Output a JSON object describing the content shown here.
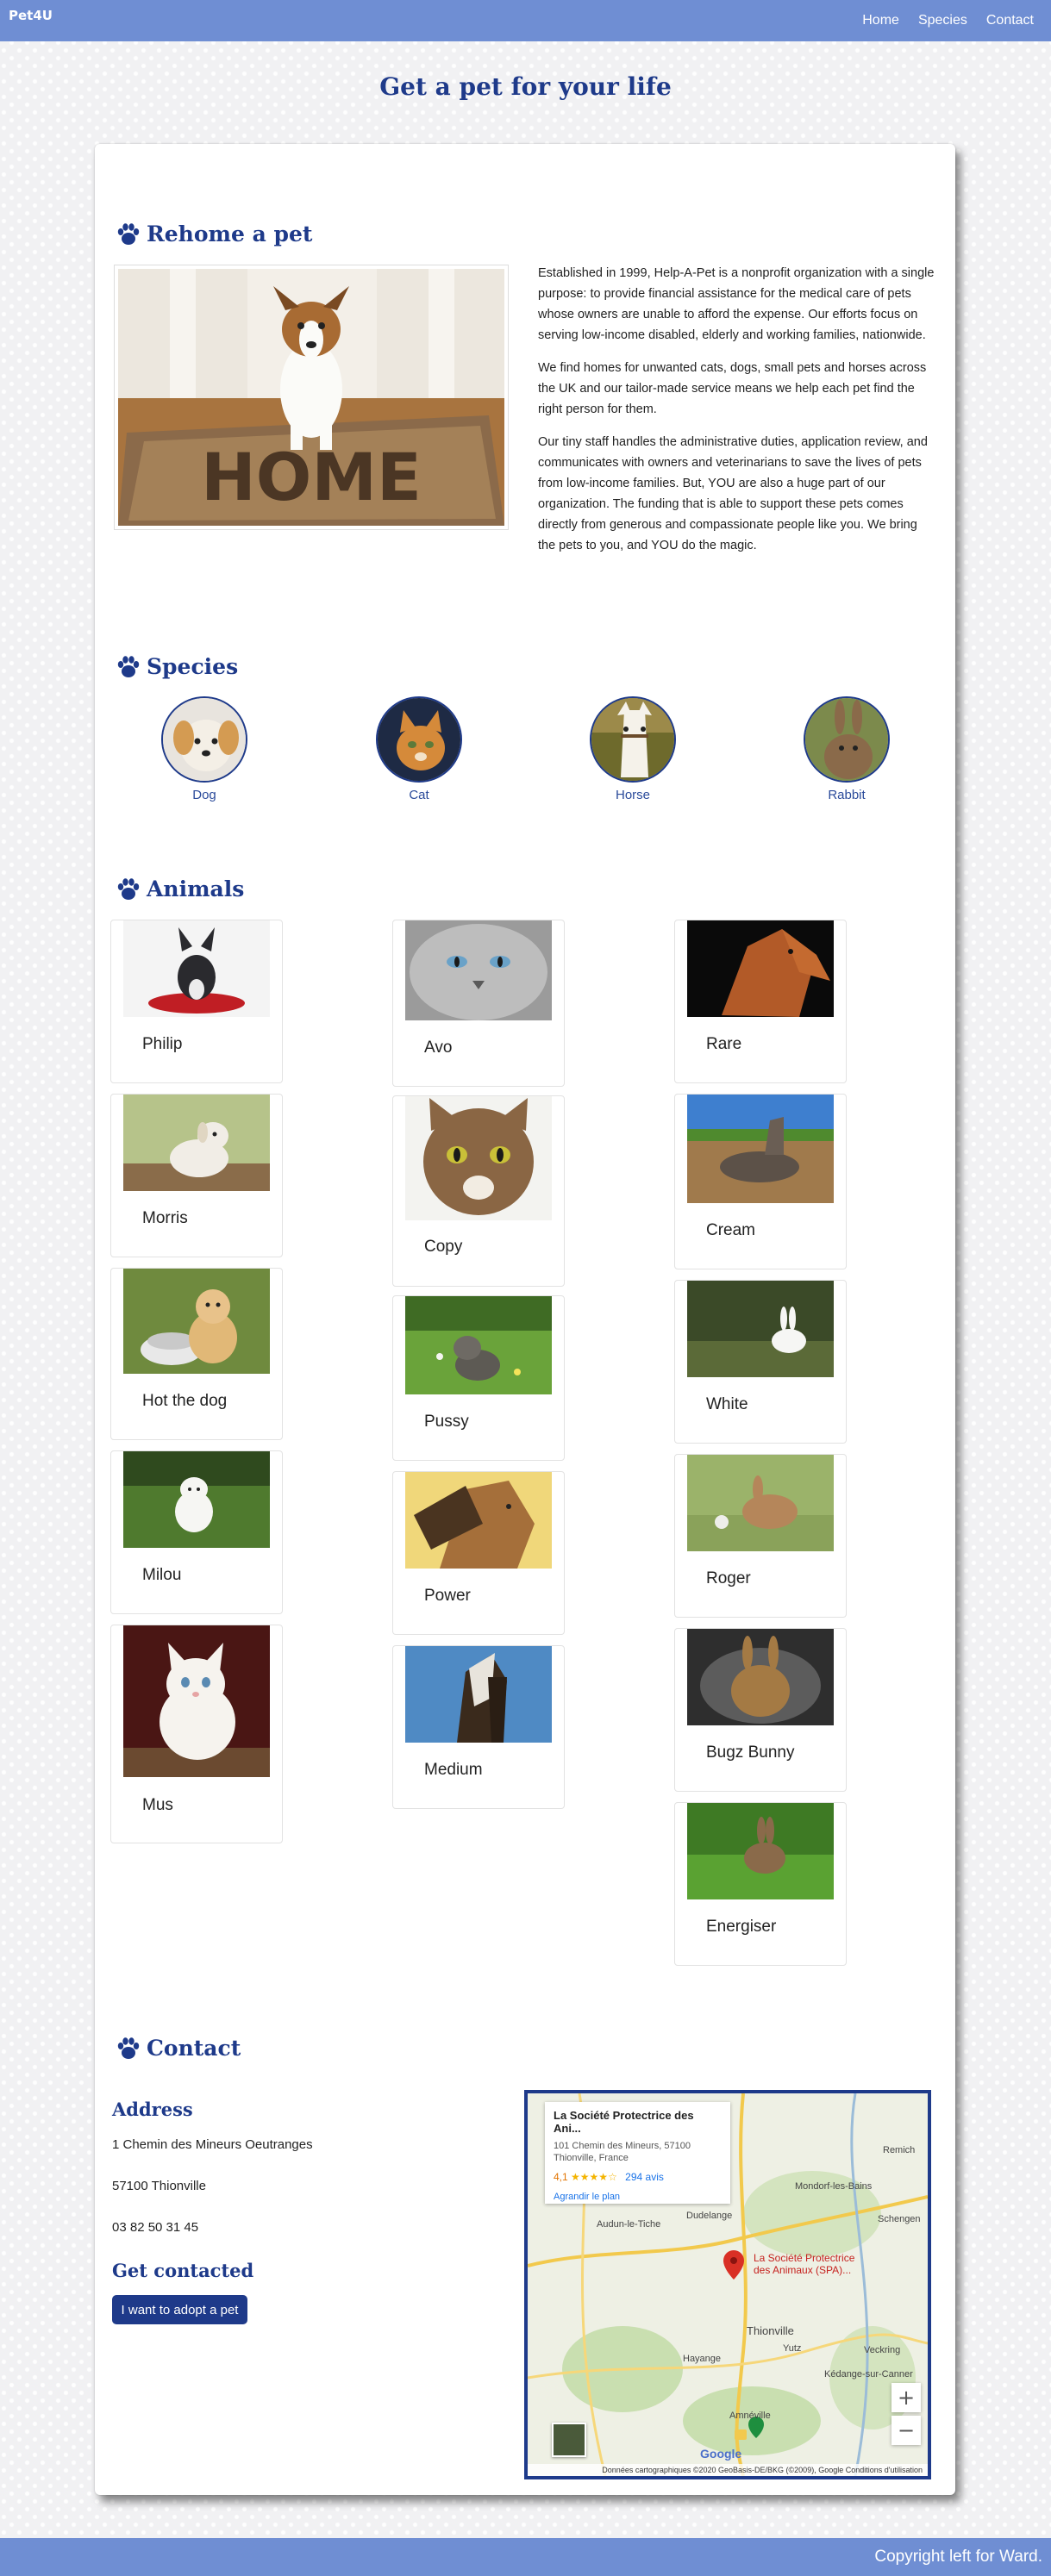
{
  "nav": {
    "brand": "Pet4U",
    "links": [
      "Home",
      "Species",
      "Contact"
    ]
  },
  "page_title": "Get a pet for your life",
  "rehome": {
    "heading": "Rehome a pet",
    "image_caption": "HOME",
    "paragraphs": [
      "Established in 1999, Help-A-Pet is a nonprofit organization with a single purpose: to provide financial assistance for the medical care of pets whose owners are unable to afford the expense. Our efforts focus on serving low-income disabled, elderly and working families, nationwide.",
      "We find homes for unwanted cats, dogs, small pets and horses across the UK and our tailor-made service means we help each pet find the right person for them.",
      "Our tiny staff handles the administrative duties, application review, and communicates with owners and veterinarians to save the lives of pets from low-income families. But, YOU are also a huge part of our organization. The funding that is able to support these pets comes directly from generous and compassionate people like you. We bring the pets to you, and YOU do the magic."
    ]
  },
  "species": {
    "heading": "Species",
    "items": [
      "Dog",
      "Cat",
      "Horse",
      "Rabbit"
    ]
  },
  "animals": {
    "heading": "Animals",
    "columns": [
      [
        "Philip",
        "Morris",
        "Hot the dog",
        "Milou",
        "Mus"
      ],
      [
        "Avo",
        "Copy",
        "Pussy",
        "Power",
        "Medium"
      ],
      [
        "Rare",
        "Cream",
        "White",
        "Roger",
        "Bugz Bunny",
        "Energiser"
      ]
    ]
  },
  "contact": {
    "heading": "Contact",
    "address_heading": "Address",
    "address_lines": [
      "1 Chemin des Mineurs Oeutranges",
      "57100 Thionville",
      "03 82 50 31 45"
    ],
    "contacted_heading": "Get contacted",
    "button_label": "I want to adopt a pet"
  },
  "map": {
    "place_name": "La Société Protectrice des Ani...",
    "address_line1": "101 Chemin des Mineurs, 57100",
    "address_line2": "Thionville, France",
    "rating": "4,1",
    "stars": "★★★★☆",
    "reviews": "294 avis",
    "enlarge": "Agrandir le plan",
    "pin_label_1": "La Société Protectrice",
    "pin_label_2": "des Animaux (SPA)...",
    "towns": [
      "Audun-le-Tiche",
      "Dudelange",
      "Mondorf-les-Bains",
      "Thionville",
      "Hayange",
      "Yutz",
      "Kédange-sur-Canner",
      "Amnéville",
      "Veckring",
      "Schengen",
      "Remich"
    ],
    "zoom_in": "+",
    "zoom_out": "−",
    "google": "Google",
    "attribution": "Données cartographiques ©2020 GeoBasis-DE/BKG (©2009), Google   Conditions d'utilisation"
  },
  "footer": "Copyright left for Ward.",
  "colors": {
    "navbar": "#6f8ed3",
    "heading": "#1e3a8a",
    "button": "#1e3a8a"
  }
}
